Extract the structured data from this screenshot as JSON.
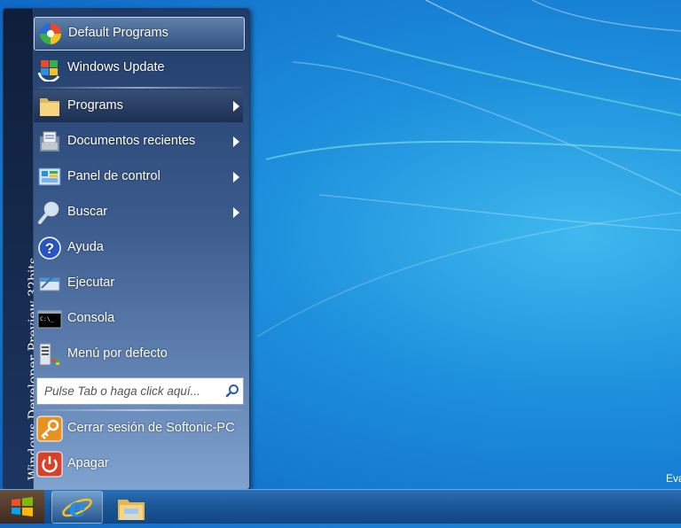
{
  "colors": {
    "desktop_accent": "#1d8fdc",
    "menu_dark": "#1c2f52",
    "taskbar": "#1a5596"
  },
  "start_menu": {
    "side_title": "Windows Developer Preview 32bits",
    "items": [
      {
        "label": "Default Programs",
        "icon": "default-programs-icon"
      },
      {
        "label": "Windows Update",
        "icon": "windows-update-icon"
      },
      {
        "label": "Programs",
        "icon": "folder-icon",
        "submenu": true
      },
      {
        "label": "Documentos recientes",
        "icon": "recent-documents-icon",
        "submenu": true
      },
      {
        "label": "Panel de control",
        "icon": "control-panel-icon",
        "submenu": true
      },
      {
        "label": "Buscar",
        "icon": "magnifier-icon",
        "submenu": true
      },
      {
        "label": "Ayuda",
        "icon": "help-icon"
      },
      {
        "label": "Ejecutar",
        "icon": "run-icon"
      },
      {
        "label": "Consola",
        "icon": "console-icon"
      },
      {
        "label": "Menú por defecto",
        "icon": "default-menu-icon"
      }
    ],
    "search": {
      "placeholder": "Pulse Tab o haga click aquí..."
    },
    "bottom": [
      {
        "label": "Cerrar sesión de Softonic-PC",
        "icon": "logoff-key-icon"
      },
      {
        "label": "Apagar",
        "icon": "power-icon"
      }
    ],
    "console_icon_text": "C:\\_"
  },
  "desktop": {
    "corner_text": "Eva"
  },
  "taskbar": {
    "start_icon": "windows-logo-icon",
    "pinned": [
      "internet-explorer-icon",
      "file-explorer-icon"
    ]
  }
}
